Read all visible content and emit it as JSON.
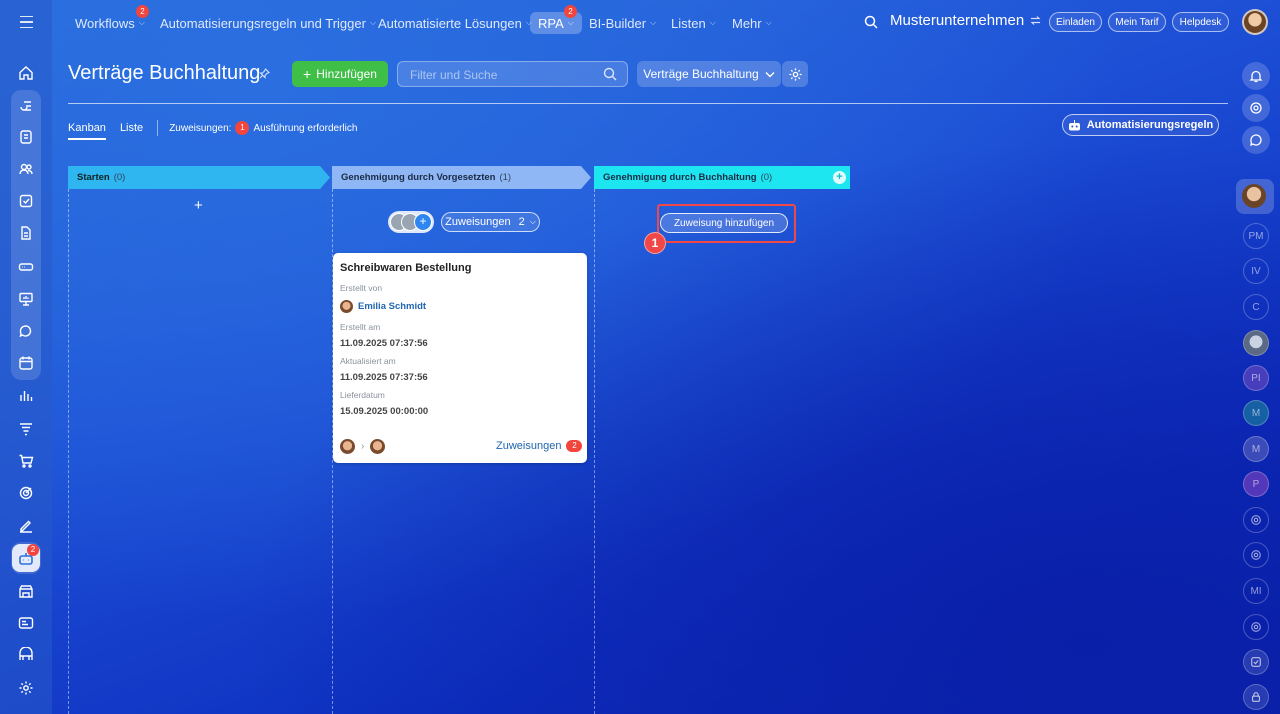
{
  "topnav": {
    "items": [
      {
        "label": "Workflows",
        "badge": "2"
      },
      {
        "label": "Automatisierungsregeln und Trigger"
      },
      {
        "label": "Automatisierte Lösungen"
      },
      {
        "label": "RPA",
        "badge": "2"
      },
      {
        "label": "BI-Builder"
      },
      {
        "label": "Listen"
      },
      {
        "label": "Mehr"
      }
    ],
    "company": "Musterunternehmen",
    "invite": "Einladen",
    "plan": "Mein Tarif",
    "helpdesk": "Helpdesk"
  },
  "sidebar": {
    "rpa_badge": "2"
  },
  "header": {
    "title": "Verträge Buchhaltung",
    "add_label": "Hinzufügen",
    "search_placeholder": "Filter und Suche",
    "category": "Verträge Buchhaltung"
  },
  "tabs": {
    "kanban": "Kanban",
    "list": "Liste",
    "assign_label": "Zuweisungen:",
    "assign_count": "1",
    "assign_text": "Ausführung erforderlich",
    "automation": "Automatisierungsregeln"
  },
  "columns": [
    {
      "title": "Starten",
      "count": "(0)"
    },
    {
      "title": "Genehmigung durch Vorgesetzten",
      "count": "(1)"
    },
    {
      "title": "Genehmigung durch Buchhaltung",
      "count": "(0)"
    }
  ],
  "column2": {
    "assign_label": "Zuweisungen",
    "assign_count": "2"
  },
  "column3": {
    "add_assignment": "Zuweisung hinzufügen",
    "callout": "1"
  },
  "card": {
    "title": "Schreibwaren Bestellung",
    "created_by_label": "Erstellt von",
    "created_by": "Emilia Schmidt",
    "created_at_label": "Erstellt am",
    "created_at": "11.09.2025 07:37:56",
    "updated_label": "Aktualisiert am",
    "updated": "11.09.2025 07:37:56",
    "delivery_label": "Lieferdatum",
    "delivery": "15.09.2025 00:00:00",
    "assign_label": "Zuweisungen",
    "assign_count": "2"
  },
  "rightbar": {
    "letters": [
      "PM",
      "IV",
      "C",
      "PI",
      "M",
      "M",
      "P",
      "MI"
    ]
  },
  "colors": {
    "accent_green": "#3fbf47",
    "badge_red": "#f1453d",
    "highlight_red": "#f04848"
  }
}
